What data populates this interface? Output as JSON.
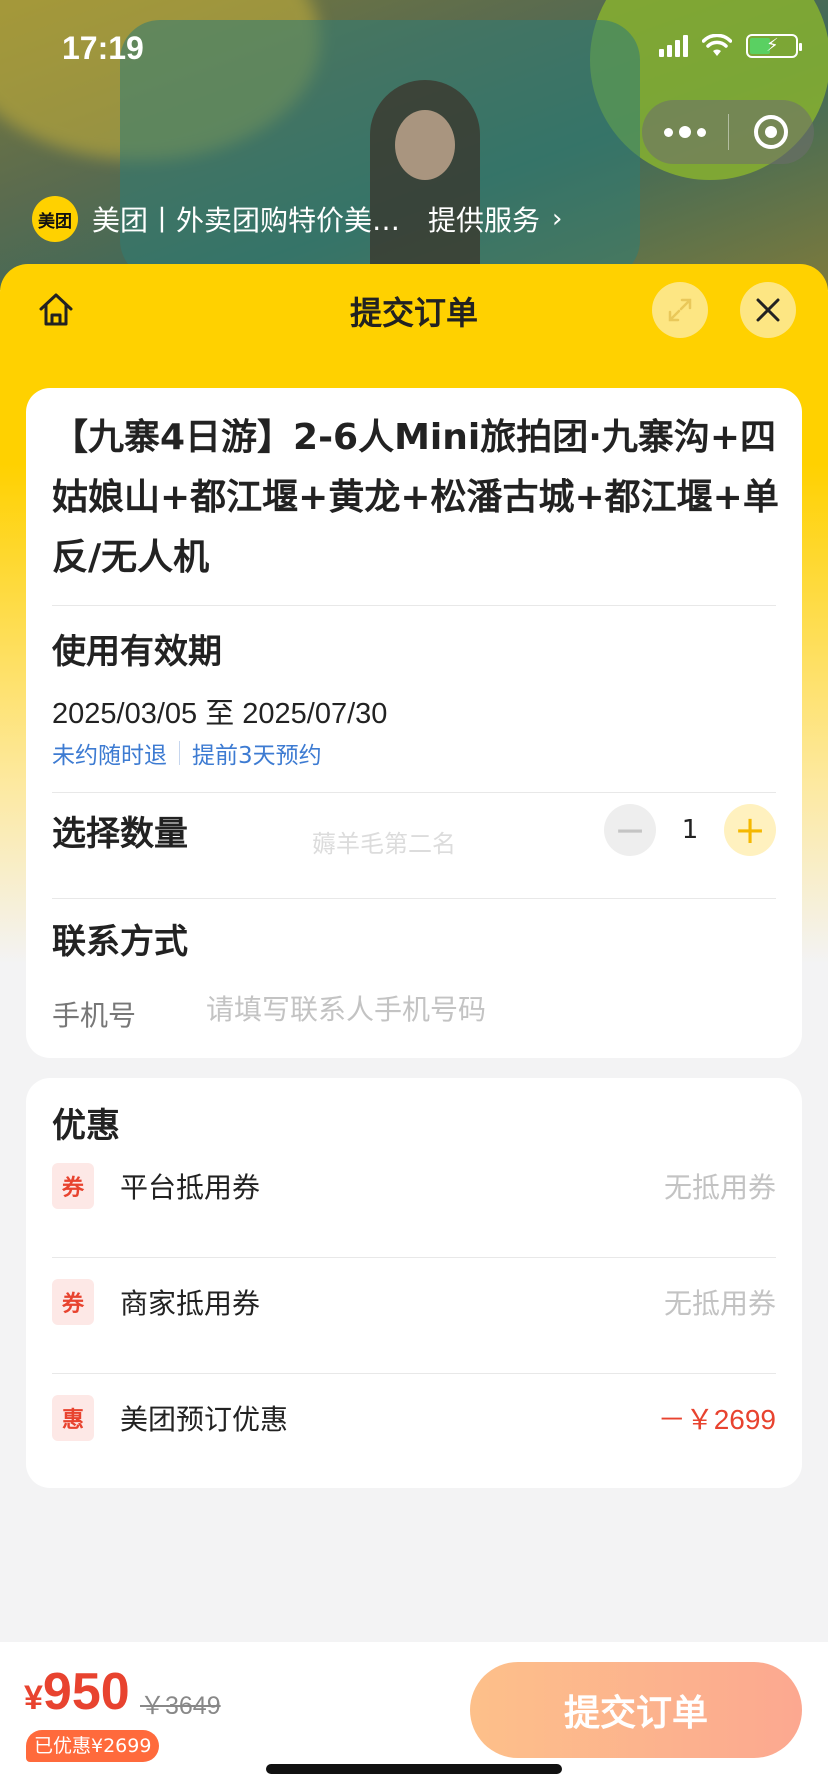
{
  "status_bar": {
    "time": "17:19"
  },
  "mini_program": {
    "title": "美团丨外卖团购特价美…",
    "service_label": "提供服务",
    "logo_text": "美团"
  },
  "sheet": {
    "title": "提交订单"
  },
  "product": {
    "title": "【九寨4日游】2-6人Mini旅拍团·九寨沟+四姑娘山+都江堰+黄龙+松潘古城+都江堰+单反/无人机"
  },
  "validity": {
    "label": "使用有效期",
    "range": "2025/03/05 至 2025/07/30",
    "tags": [
      "未约随时退",
      "提前3天预约"
    ]
  },
  "quantity": {
    "label": "选择数量",
    "value": "1",
    "watermark": "薅羊毛第二名"
  },
  "contact": {
    "label": "联系方式",
    "phone_label": "手机号",
    "phone_placeholder": "请填写联系人手机号码",
    "phone_value": ""
  },
  "discount": {
    "label": "优惠",
    "items": [
      {
        "badge": "券",
        "name": "平台抵用券",
        "value": "无抵用券"
      },
      {
        "badge": "券",
        "name": "商家抵用券",
        "value": "无抵用券"
      },
      {
        "badge": "惠",
        "name": "美团预订优惠",
        "value": "－￥2699"
      }
    ]
  },
  "footer": {
    "currency": "¥",
    "price": "950",
    "original_price": "￥3649",
    "saved": "已优惠¥2699",
    "submit_label": "提交订单"
  },
  "colors": {
    "brand_yellow": "#ffd100",
    "price_red": "#e8432f",
    "link_blue": "#3d7bd2",
    "submit_gradient_start": "#fdc08a",
    "submit_gradient_end": "#fca890"
  }
}
